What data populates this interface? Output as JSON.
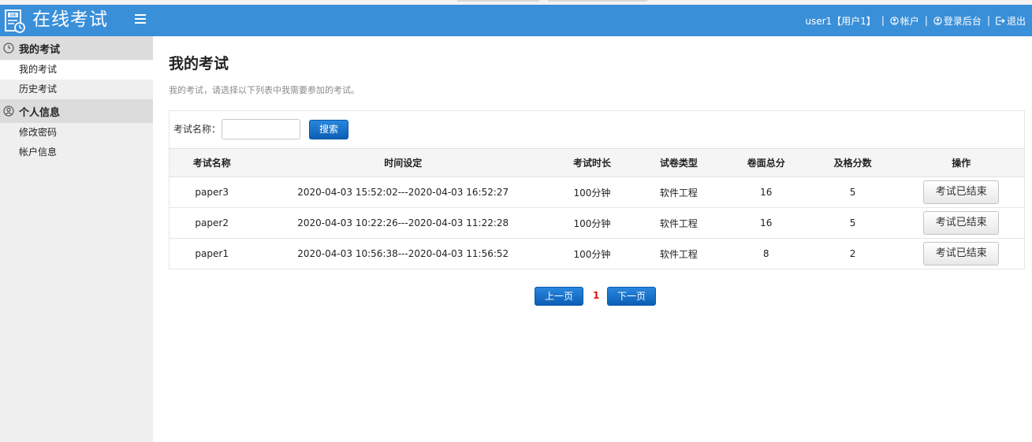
{
  "header": {
    "title": "在线考试",
    "user": "user1【用户1】",
    "account": "帐户",
    "admin_login": "登录后台",
    "logout": "退出",
    "brand_color": "#3a8fd9"
  },
  "sidebar": {
    "groups": [
      {
        "label": "我的考试",
        "icon": "clock-icon",
        "items": [
          {
            "label": "我的考试"
          },
          {
            "label": "历史考试"
          }
        ]
      },
      {
        "label": "个人信息",
        "icon": "user-circle-icon",
        "items": [
          {
            "label": "修改密码"
          },
          {
            "label": "帐户信息"
          }
        ]
      }
    ]
  },
  "main": {
    "title": "我的考试",
    "description": "我的考试，请选择以下列表中我需要参加的考试。",
    "search": {
      "label": "考试名称：",
      "value": "",
      "button": "搜索"
    },
    "table": {
      "columns": [
        "考试名称",
        "时间设定",
        "考试时长",
        "试卷类型",
        "卷面总分",
        "及格分数",
        "操作"
      ],
      "rows": [
        {
          "name": "paper3",
          "time": "2020-04-03 15:52:02---2020-04-03 16:52:27",
          "duration": "100分钟",
          "type": "软件工程",
          "total": "16",
          "pass": "5",
          "action": "考试已结束"
        },
        {
          "name": "paper2",
          "time": "2020-04-03 10:22:26---2020-04-03 11:22:28",
          "duration": "100分钟",
          "type": "软件工程",
          "total": "16",
          "pass": "5",
          "action": "考试已结束"
        },
        {
          "name": "paper1",
          "time": "2020-04-03 10:56:38---2020-04-03 11:56:52",
          "duration": "100分钟",
          "type": "软件工程",
          "total": "8",
          "pass": "2",
          "action": "考试已结束"
        }
      ]
    },
    "pager": {
      "prev": "上一页",
      "current": "1",
      "next": "下一页"
    }
  }
}
